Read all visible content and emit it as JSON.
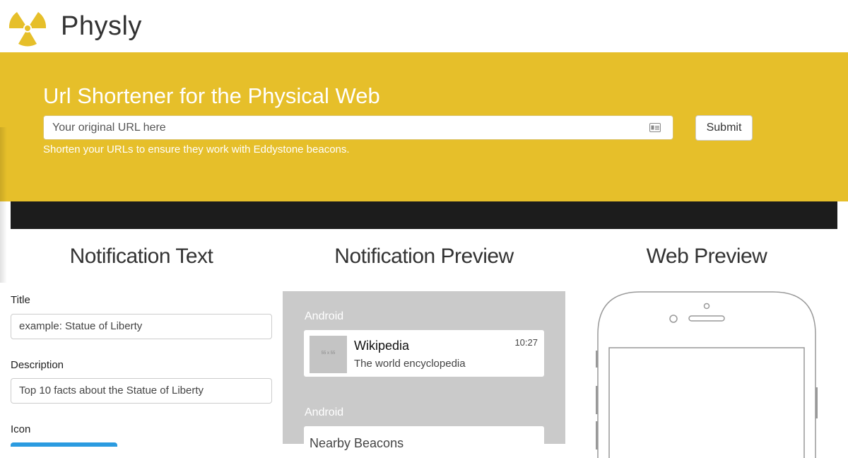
{
  "header": {
    "brand": "Physly",
    "logo_icon": "radiation-logo-icon"
  },
  "hero": {
    "title": "Url Shortener for the Physical Web",
    "url_placeholder": "Your original URL here",
    "submit_label": "Submit",
    "hint": "Shorten your URLs to ensure they work with Eddystone beacons."
  },
  "columns": {
    "notification_text": "Notification Text",
    "notification_preview": "Notification Preview",
    "web_preview": "Web Preview"
  },
  "form": {
    "title_label": "Title",
    "title_value": "example: Statue of Liberty",
    "description_label": "Description",
    "description_value": "Top 10 facts about the Statue of Liberty",
    "icon_label": "Icon"
  },
  "preview": {
    "android_label_1": "Android",
    "notification": {
      "thumb_text": "55 x 55",
      "title": "Wikipedia",
      "subtitle": "The world encyclopedia",
      "time": "10:27"
    },
    "android_label_2": "Android",
    "second_notification_title": "Nearby Beacons"
  },
  "colors": {
    "accent": "#e6bf2a",
    "dark_band": "#1c1c1c",
    "preview_bg": "#cacaca",
    "button_blue": "#2b9be0"
  }
}
